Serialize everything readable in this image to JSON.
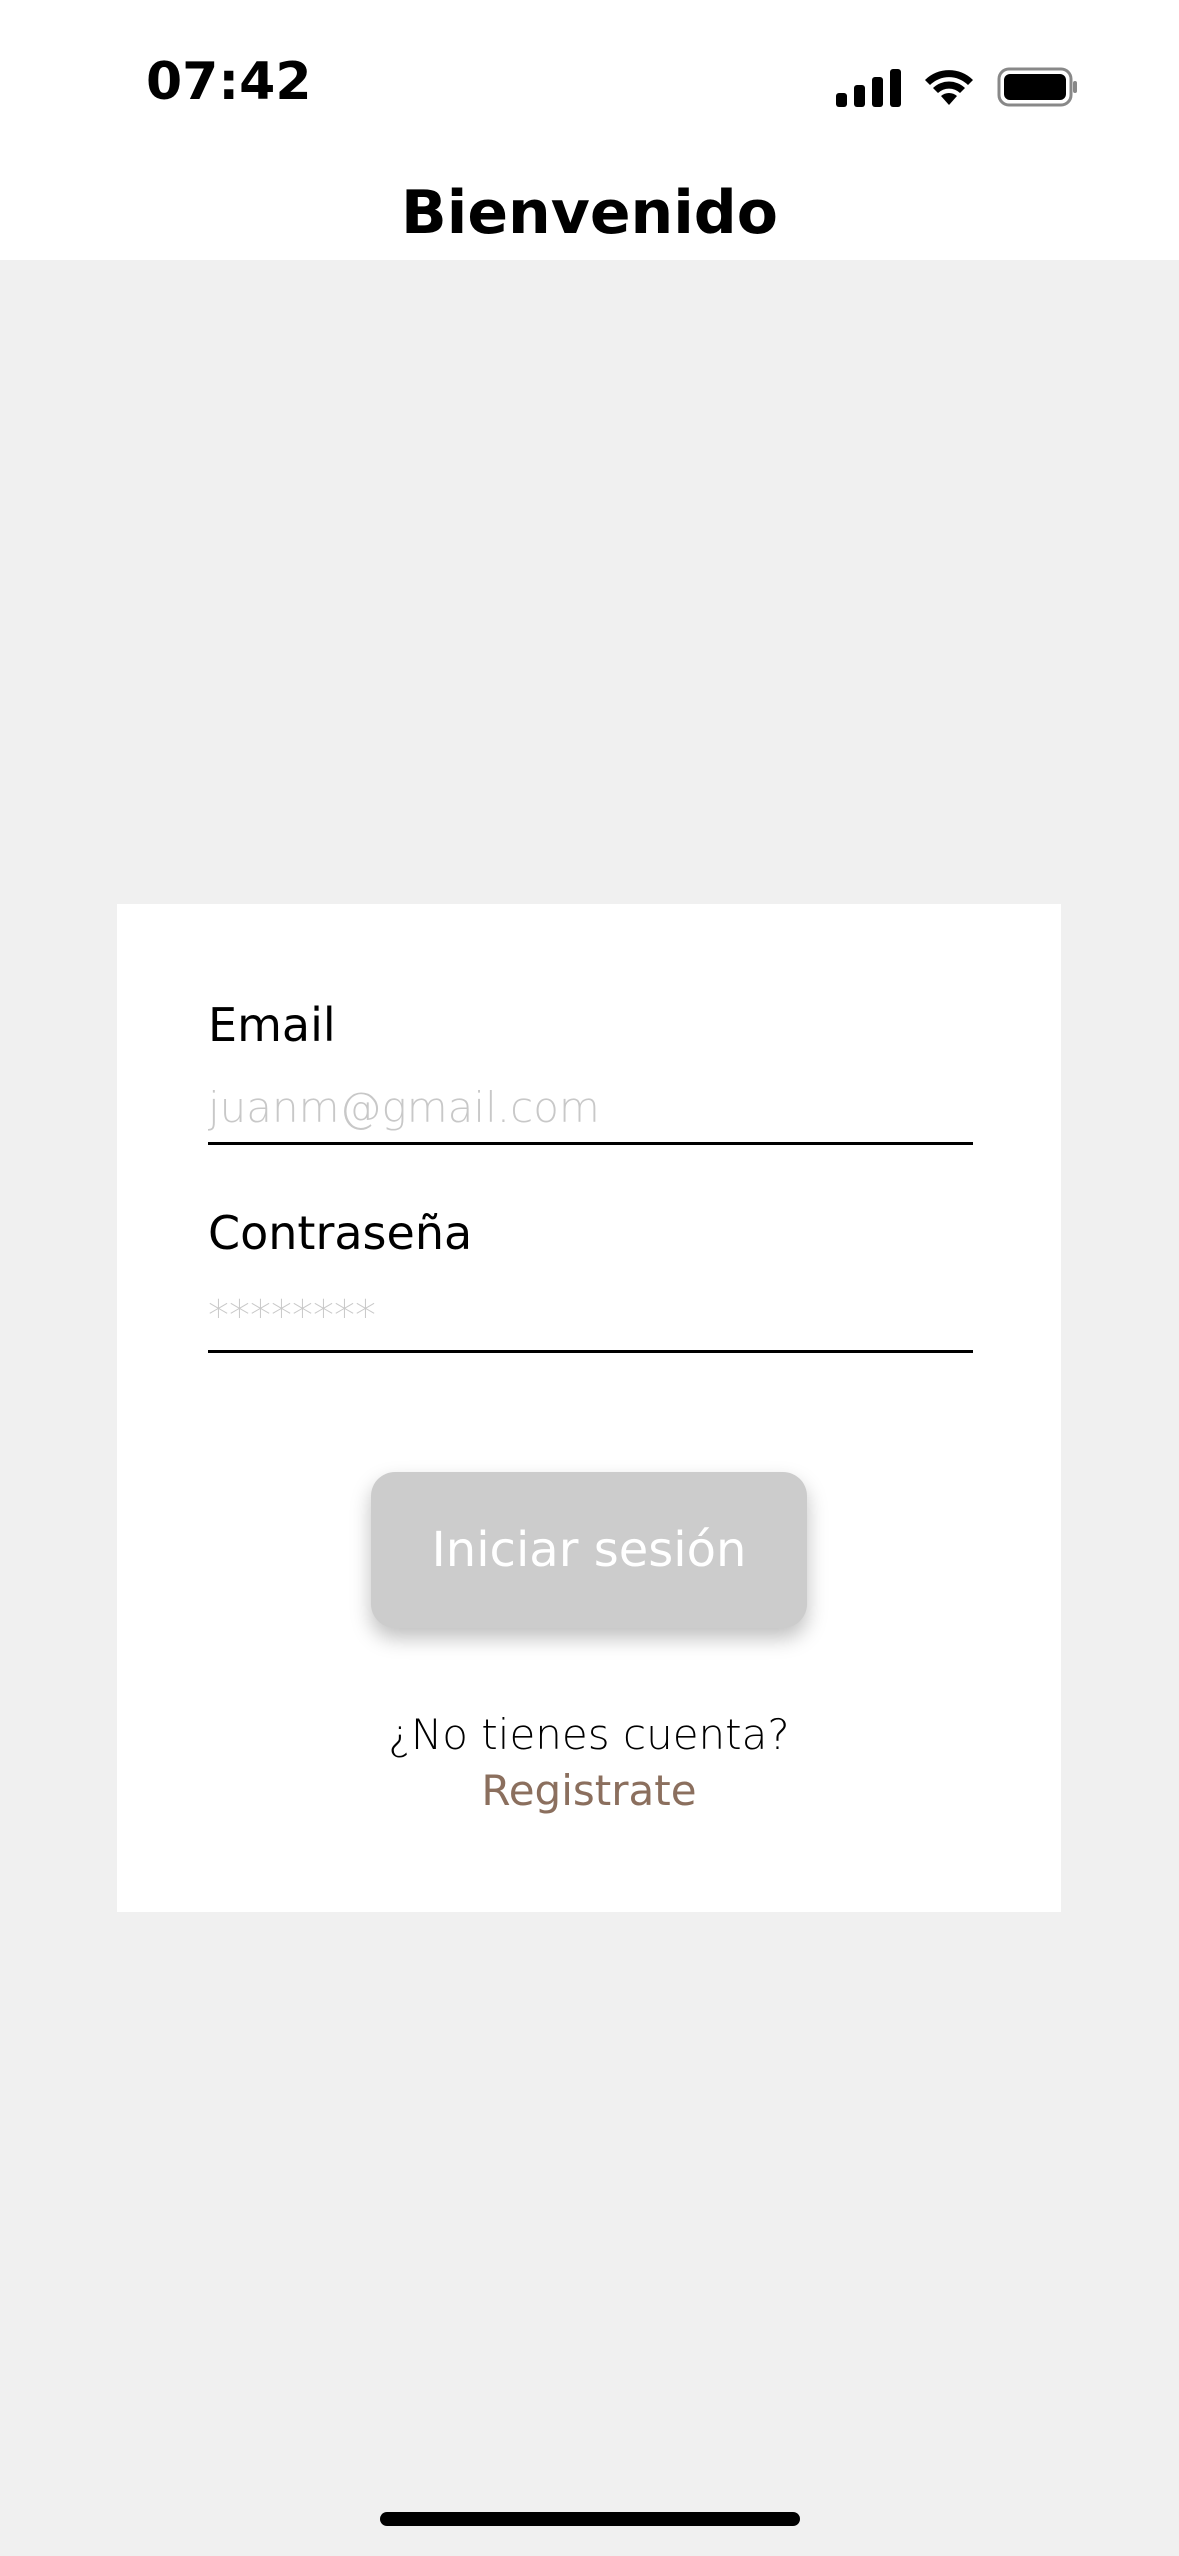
{
  "status_bar": {
    "time": "07:42",
    "icons": [
      "signal-icon",
      "wifi-icon",
      "battery-icon"
    ]
  },
  "header": {
    "title": "Bienvenido"
  },
  "login_form": {
    "email_label": "Email",
    "email_placeholder": "juanm@gmail.com",
    "email_value": "",
    "password_label": "Contraseña",
    "password_placeholder": "********",
    "password_value": "",
    "submit_label": "Iniciar sesión",
    "no_account_text": "¿No tienes cuenta?",
    "register_label": "Registrate"
  },
  "colors": {
    "background": "#f0f0f0",
    "card": "#ffffff",
    "button_disabled": "#cccccc",
    "link_accent": "#8b6f5e"
  }
}
